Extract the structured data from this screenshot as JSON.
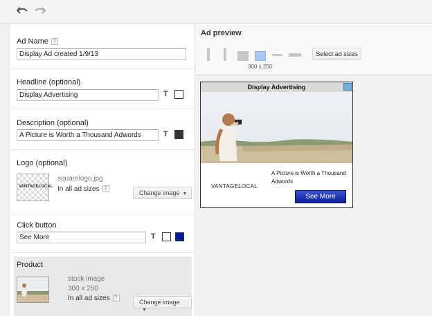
{
  "toolbar": {
    "undo": "undo-icon",
    "redo": "redo-icon"
  },
  "form": {
    "ad_name": {
      "label": "Ad Name",
      "value": "Display Ad created 1/9/13"
    },
    "headline": {
      "label": "Headline  (optional)",
      "value": "Display Advertising",
      "color": "#ffffff"
    },
    "description": {
      "label": "Description  (optional)",
      "value": "A Picture is Worth a Thousand Adwords",
      "color": "#333333"
    },
    "logo": {
      "label": "Logo  (optional)",
      "logo_text": "VANTAGELOCAL",
      "file": "squarelogo.jpg",
      "sizes": "In all ad sizes",
      "change": "Change image"
    },
    "click_button": {
      "label": "Click button",
      "value": "See More",
      "text_color": "#ffffff",
      "button_color": "#001a99"
    },
    "product": {
      "label": "Product",
      "name": "stock image",
      "dims": "300 x 250",
      "sizes": "In all ad sizes",
      "change": "Change image"
    }
  },
  "preview": {
    "title": "Ad preview",
    "selected_size": "300 x 250",
    "select_sizes_label": "Select ad sizes",
    "ad": {
      "headline": "Display Advertising",
      "brand": "VANTAGELOCAL",
      "description": "A Picture is Worth a Thousand Adwords",
      "cta": "See More"
    }
  },
  "colors": {
    "accent_blue": "#a7c9f2",
    "cta_blue": "#0c1f9a"
  }
}
